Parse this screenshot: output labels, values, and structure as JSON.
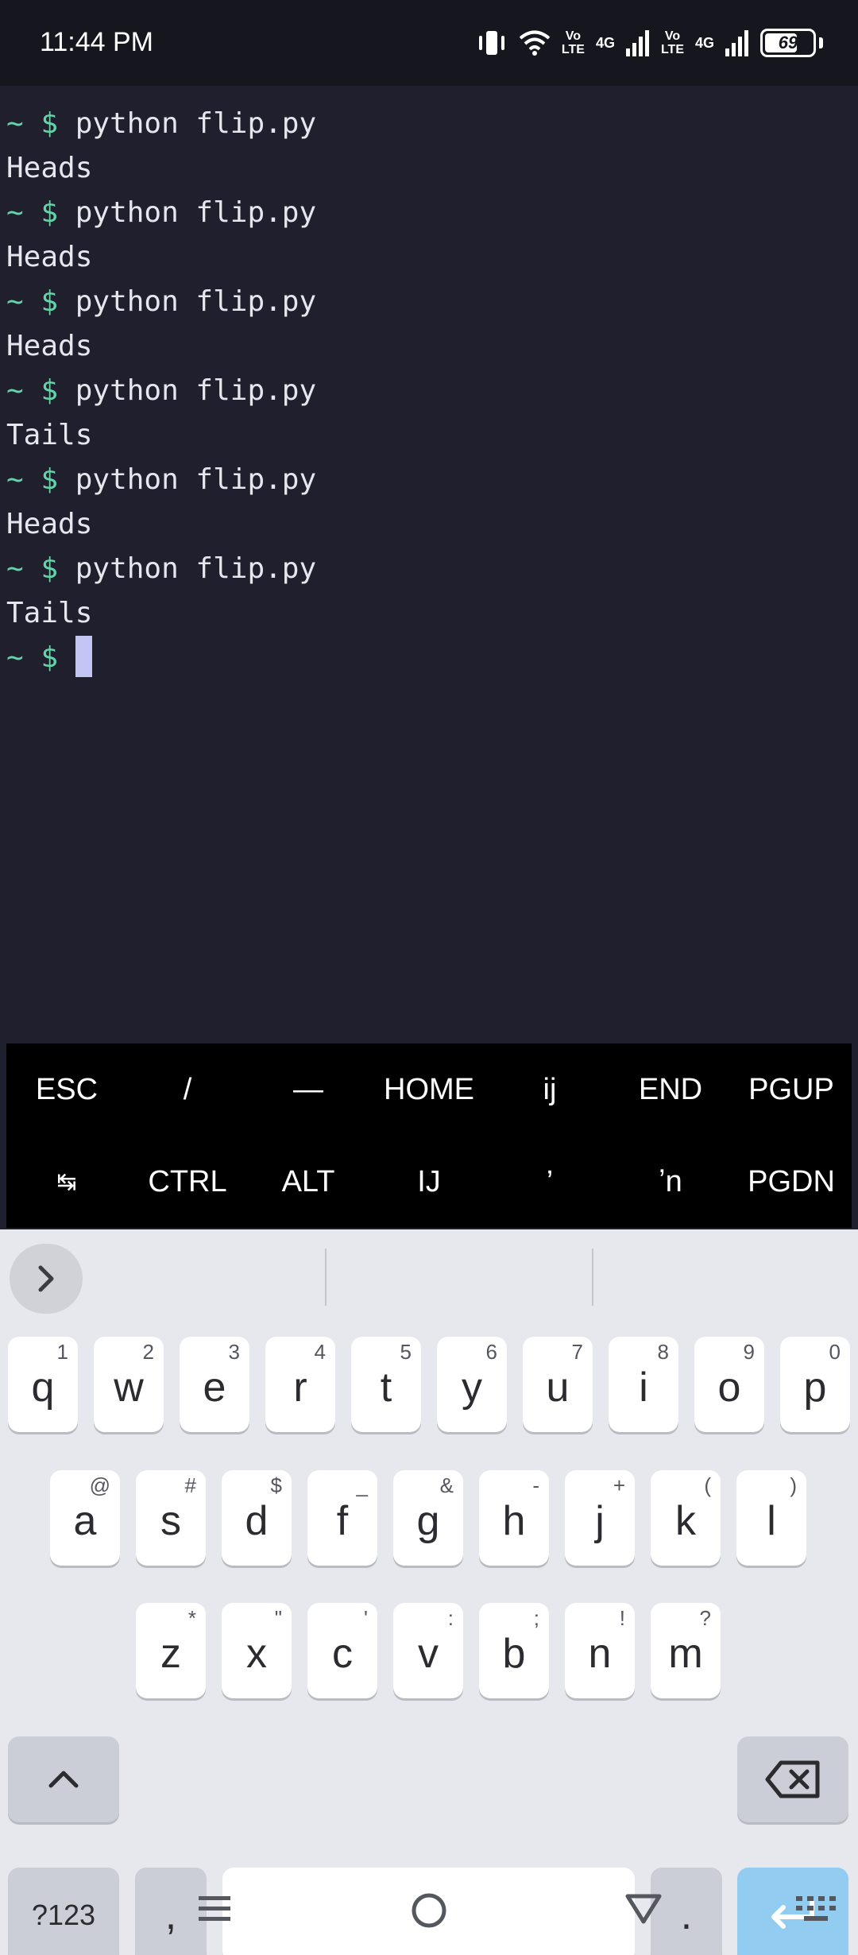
{
  "status_bar": {
    "time": "11:44 PM",
    "battery_level": "69",
    "battery_fraction": 0.69,
    "volte1": [
      "Vo",
      "LTE"
    ],
    "volte2": [
      "Vo",
      "LTE"
    ],
    "net1": "4G",
    "net2": "4G",
    "icons": [
      "vibrate-icon",
      "wifi-icon",
      "signal-icon",
      "battery-icon"
    ]
  },
  "terminal": {
    "prompt": "~ $",
    "lines": [
      {
        "type": "command",
        "text": "python flip.py"
      },
      {
        "type": "output",
        "text": "Heads"
      },
      {
        "type": "command",
        "text": "python flip.py"
      },
      {
        "type": "output",
        "text": "Heads"
      },
      {
        "type": "command",
        "text": "python flip.py"
      },
      {
        "type": "output",
        "text": "Heads"
      },
      {
        "type": "command",
        "text": "python flip.py"
      },
      {
        "type": "output",
        "text": "Tails"
      },
      {
        "type": "command",
        "text": "python flip.py"
      },
      {
        "type": "output",
        "text": "Heads"
      },
      {
        "type": "command",
        "text": "python flip.py"
      },
      {
        "type": "output",
        "text": "Tails"
      }
    ]
  },
  "extra_keys": {
    "row1": [
      "ESC",
      "/",
      "—",
      "HOME",
      "ij",
      "END",
      "PGUP"
    ],
    "row2": [
      "↹",
      "CTRL",
      "ALT",
      "IJ",
      "’",
      "ʼn",
      "PGDN"
    ]
  },
  "keyboard": {
    "row1": [
      {
        "key": "q",
        "hint": "1"
      },
      {
        "key": "w",
        "hint": "2"
      },
      {
        "key": "e",
        "hint": "3"
      },
      {
        "key": "r",
        "hint": "4"
      },
      {
        "key": "t",
        "hint": "5"
      },
      {
        "key": "y",
        "hint": "6"
      },
      {
        "key": "u",
        "hint": "7"
      },
      {
        "key": "i",
        "hint": "8"
      },
      {
        "key": "o",
        "hint": "9"
      },
      {
        "key": "p",
        "hint": "0"
      }
    ],
    "row2": [
      {
        "key": "a",
        "hint": "@"
      },
      {
        "key": "s",
        "hint": "#"
      },
      {
        "key": "d",
        "hint": "$"
      },
      {
        "key": "f",
        "hint": "_"
      },
      {
        "key": "g",
        "hint": "&"
      },
      {
        "key": "h",
        "hint": "-"
      },
      {
        "key": "j",
        "hint": "+"
      },
      {
        "key": "k",
        "hint": "("
      },
      {
        "key": "l",
        "hint": ")"
      }
    ],
    "row3": [
      {
        "key": "z",
        "hint": "*"
      },
      {
        "key": "x",
        "hint": "\""
      },
      {
        "key": "c",
        "hint": "'"
      },
      {
        "key": "v",
        "hint": ":"
      },
      {
        "key": "b",
        "hint": ";"
      },
      {
        "key": "n",
        "hint": "!"
      },
      {
        "key": "m",
        "hint": "?"
      }
    ],
    "symbols_label": "?123",
    "comma_label": ",",
    "period_label": ".",
    "accent_color": "#92cdf1"
  },
  "nav_bar": {
    "icons": [
      "menu-nav-icon",
      "home-nav-icon",
      "back-nav-icon",
      "keyboard-switch-icon"
    ]
  }
}
